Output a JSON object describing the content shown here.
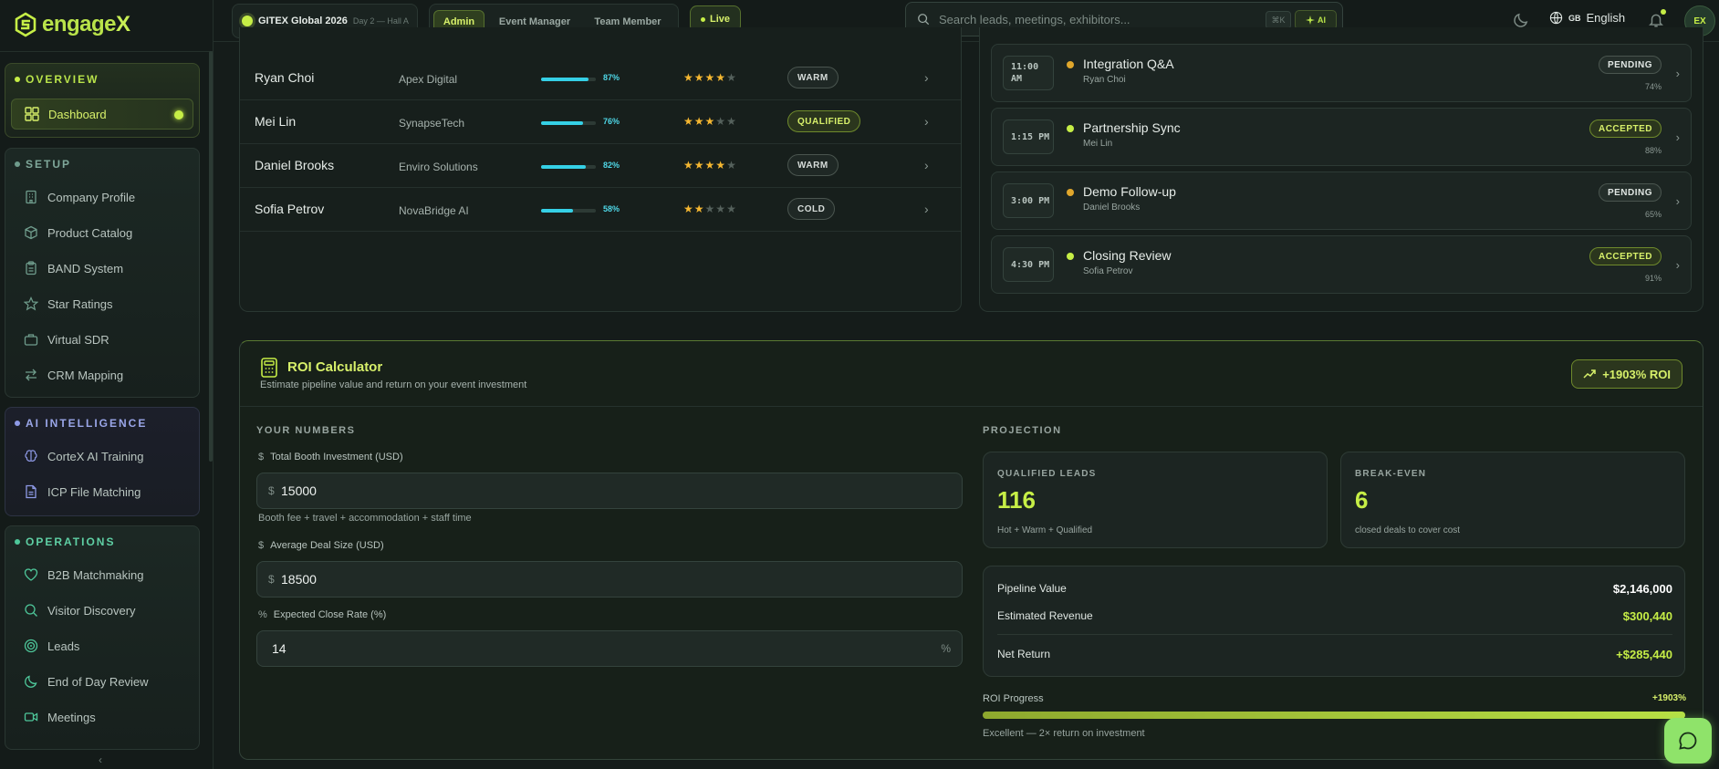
{
  "brand": {
    "logo_text_main": "engage",
    "logo_text_accent": "X",
    "accent_color": "#c6ee46"
  },
  "sidebar": {
    "overview": {
      "title": "OVERVIEW",
      "items": [
        {
          "label": "Dashboard",
          "icon": "dashboard-icon"
        }
      ]
    },
    "setup": {
      "title": "SETUP",
      "items": [
        {
          "label": "Company Profile",
          "icon": "building-icon"
        },
        {
          "label": "Product Catalog",
          "icon": "box-icon"
        },
        {
          "label": "BAND System",
          "icon": "clipboard-icon"
        },
        {
          "label": "Star Ratings",
          "icon": "star-icon"
        },
        {
          "label": "Virtual SDR",
          "icon": "briefcase-icon"
        },
        {
          "label": "CRM Mapping",
          "icon": "arrows-icon"
        }
      ]
    },
    "ai": {
      "title": "AI INTELLIGENCE",
      "items": [
        {
          "label": "CorteX AI Training",
          "icon": "brain-icon"
        },
        {
          "label": "ICP File Matching",
          "icon": "file-icon"
        }
      ]
    },
    "operations": {
      "title": "OPERATIONS",
      "items": [
        {
          "label": "B2B Matchmaking",
          "icon": "heart-icon"
        },
        {
          "label": "Visitor Discovery",
          "icon": "search-icon"
        },
        {
          "label": "Leads",
          "icon": "target-icon"
        },
        {
          "label": "End of Day Review",
          "icon": "moon-icon"
        },
        {
          "label": "Meetings",
          "icon": "video-icon"
        }
      ]
    },
    "collapse_glyph": "‹"
  },
  "topbar": {
    "event_name": "GITEX Global 2026",
    "event_sub": "Day 2 — Hall A",
    "roles": [
      "Admin",
      "Event Manager",
      "Team Member"
    ],
    "active_role": "Admin",
    "live_label": "Live",
    "search_placeholder": "Search leads, meetings, exhibitors...",
    "search_kbd": "⌘K",
    "ai_chip": "AI",
    "lang_code": "GB",
    "lang_label": "English",
    "avatar_initials": "EX"
  },
  "leads": [
    {
      "name": "Ryan Choi",
      "company": "Apex Digital",
      "score": "87%",
      "score_value": 87,
      "stars": 4,
      "status": "WARM",
      "status_type": "warm"
    },
    {
      "name": "Mei Lin",
      "company": "SynapseTech",
      "score": "76%",
      "score_value": 76,
      "stars": 3,
      "status": "QUALIFIED",
      "status_type": "qual"
    },
    {
      "name": "Daniel Brooks",
      "company": "Enviro Solutions",
      "score": "82%",
      "score_value": 82,
      "stars": 4,
      "status": "WARM",
      "status_type": "warm"
    },
    {
      "name": "Sofia Petrov",
      "company": "NovaBridge AI",
      "score": "58%",
      "score_value": 58,
      "stars": 2,
      "status": "COLD",
      "status_type": "cold"
    }
  ],
  "meetings": [
    {
      "time": "11:00 AM",
      "title": "Integration Q&A",
      "who": "Ryan Choi",
      "status": "PENDING",
      "status_type": "pending",
      "score": "74%",
      "dot_color": "#e0a72c"
    },
    {
      "time": "1:15 PM",
      "title": "Partnership Sync",
      "who": "Mei Lin",
      "status": "ACCEPTED",
      "status_type": "accepted",
      "score": "88%",
      "dot_color": "#c6ee46"
    },
    {
      "time": "3:00 PM",
      "title": "Demo Follow-up",
      "who": "Daniel Brooks",
      "status": "PENDING",
      "status_type": "pending",
      "score": "65%",
      "dot_color": "#e0a72c"
    },
    {
      "time": "4:30 PM",
      "title": "Closing Review",
      "who": "Sofia Petrov",
      "status": "ACCEPTED",
      "status_type": "accepted",
      "score": "91%",
      "dot_color": "#c6ee46"
    }
  ],
  "roi": {
    "title": "ROI Calculator",
    "subtitle": "Estimate pipeline value and return on your event investment",
    "roi_badge": "+1903% ROI",
    "your_numbers_label": "YOUR NUMBERS",
    "projection_label": "PROJECTION",
    "fields": {
      "investment_label": "Total Booth Investment (USD)",
      "investment_value": "15000",
      "investment_prefix": "$",
      "investment_hint": "Booth fee + travel + accommodation + staff time",
      "deal_label": "Average Deal Size (USD)",
      "deal_value": "18500",
      "deal_prefix": "$",
      "close_label": "Expected Close Rate (%)",
      "close_value": "14",
      "close_suffix": "%"
    },
    "qualified": {
      "label": "QUALIFIED LEADS",
      "value": "116",
      "sub": "Hot + Warm + Qualified"
    },
    "breakeven": {
      "label": "BREAK-EVEN",
      "value": "6",
      "sub": "closed deals to cover cost"
    },
    "summary": {
      "pipeline_label": "Pipeline Value",
      "pipeline_value": "$2,146,000",
      "revenue_label": "Estimated Revenue",
      "revenue_value": "$300,440",
      "net_label": "Net Return",
      "net_value": "+$285,440"
    },
    "progress": {
      "label": "ROI Progress",
      "value_text": "+1903%",
      "fill_fraction": 1.0,
      "note": "Excellent — 2× return on investment"
    }
  }
}
